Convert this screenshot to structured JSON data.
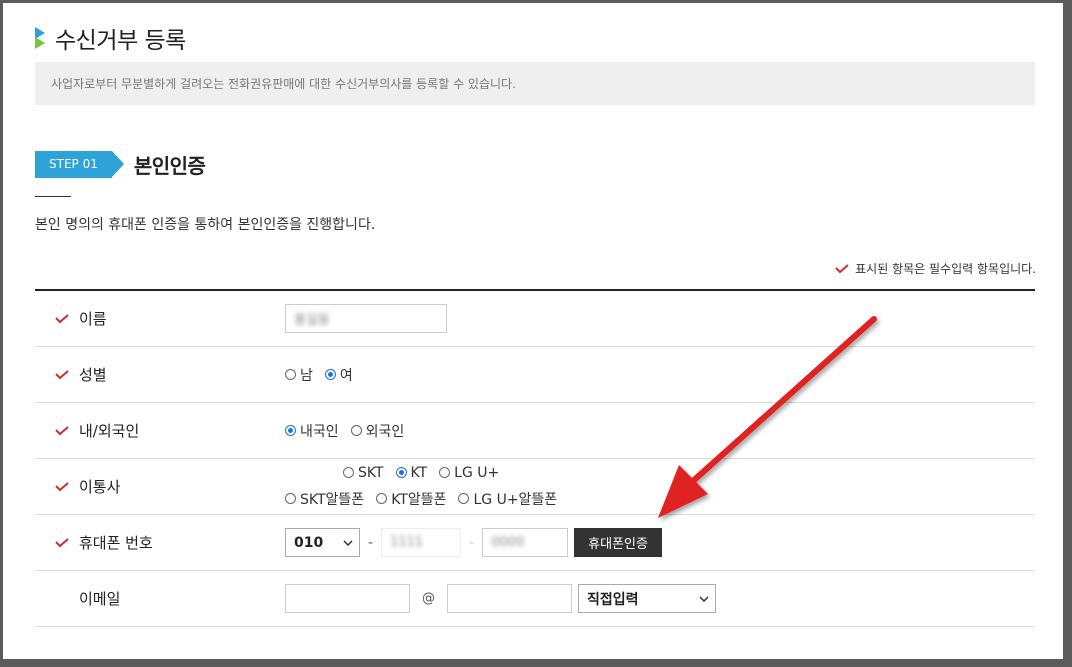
{
  "page": {
    "title": "수신거부 등록",
    "notice": "사업자로부터 무분별하게 걸려오는 전화권유판매에 대한 수신거부의사를 등록할 수 있습니다.",
    "accent_color": "#2ea3d8",
    "check_color": "#d62b2b"
  },
  "step": {
    "badge": "STEP 01",
    "title": "본인인증",
    "description": "본인 명의의 휴대폰 인증을 통하여 본인인증을 진행합니다."
  },
  "required_note": "표시된 항목은 필수입력 항목입니다.",
  "form": {
    "name": {
      "label": "이름",
      "value": "홍길동"
    },
    "gender": {
      "label": "성별",
      "options": [
        "남",
        "여"
      ],
      "selected": "여"
    },
    "nationality": {
      "label": "내/외국인",
      "options": [
        "내국인",
        "외국인"
      ],
      "selected": "내국인"
    },
    "carrier": {
      "label": "이통사",
      "options_row1": [
        "SKT",
        "KT",
        "LG U+"
      ],
      "options_row2": [
        "SKT알뜰폰",
        "KT알뜰폰",
        "LG U+알뜰폰"
      ],
      "selected": "KT"
    },
    "phone": {
      "label": "휴대폰 번호",
      "prefix": "010",
      "dash": "-",
      "middle": "1111",
      "last": "0000",
      "verify_button": "휴대폰인증"
    },
    "email": {
      "label": "이메일",
      "at": "@",
      "domain_select": "직접입력",
      "user_value": "",
      "domain_value": ""
    }
  }
}
